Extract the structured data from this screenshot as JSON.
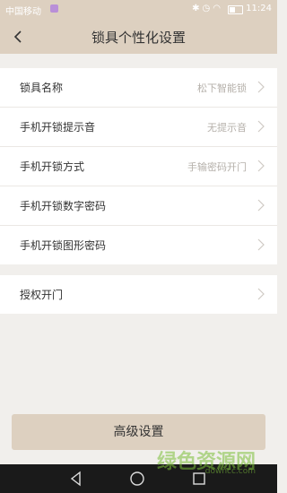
{
  "status_bar": {
    "carrier": "中国移动",
    "time": "11:24",
    "icons": [
      "bluetooth-icon",
      "alarm-icon",
      "wifi-icon",
      "battery-icon"
    ]
  },
  "header": {
    "title": "锁具个性化设置",
    "back_icon": "chevron-left-icon"
  },
  "settings": {
    "group1": [
      {
        "label": "锁具名称",
        "value": "松下智能锁"
      },
      {
        "label": "手机开锁提示音",
        "value": "无提示音"
      },
      {
        "label": "手机开锁方式",
        "value": "手输密码开门"
      },
      {
        "label": "手机开锁数字密码",
        "value": ""
      },
      {
        "label": "手机开锁图形密码",
        "value": ""
      }
    ],
    "group2": [
      {
        "label": "授权开门",
        "value": ""
      }
    ]
  },
  "advanced_button": {
    "label": "高级设置"
  },
  "watermark": {
    "text": "绿色资源网",
    "url": "downcc.com"
  },
  "colors": {
    "header_bg": "#ddd0c0",
    "page_bg": "#f1efec",
    "value_text": "#b5b0aa"
  }
}
